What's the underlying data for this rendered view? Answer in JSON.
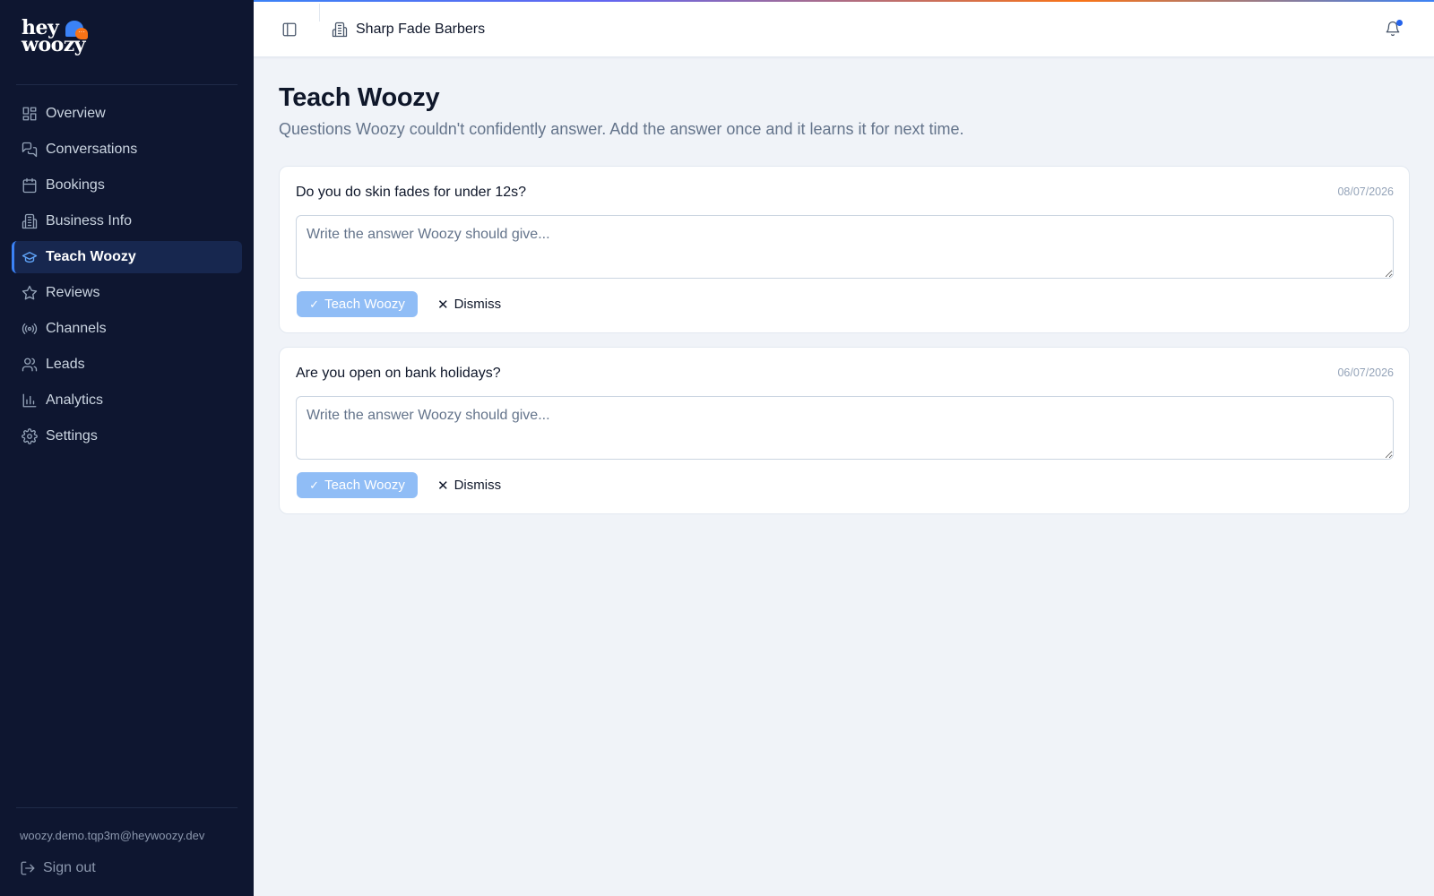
{
  "brand": {
    "line1": "hey",
    "line2": "woozy",
    "bubble_glyph": "···",
    "colors": {
      "blue": "#3b82f6",
      "orange": "#f97316"
    }
  },
  "sidebar": {
    "items": [
      {
        "label": "Overview",
        "icon": "dashboard-icon"
      },
      {
        "label": "Conversations",
        "icon": "chat-icon"
      },
      {
        "label": "Bookings",
        "icon": "calendar-icon"
      },
      {
        "label": "Business Info",
        "icon": "building-icon"
      },
      {
        "label": "Teach Woozy",
        "icon": "graduation-cap-icon",
        "active": true
      },
      {
        "label": "Reviews",
        "icon": "star-icon"
      },
      {
        "label": "Channels",
        "icon": "broadcast-icon"
      },
      {
        "label": "Leads",
        "icon": "users-icon"
      },
      {
        "label": "Analytics",
        "icon": "bar-chart-icon"
      },
      {
        "label": "Settings",
        "icon": "gear-icon"
      }
    ],
    "email": "woozy.demo.tqp3m@heywoozy.dev",
    "sign_out": "Sign out"
  },
  "topbar": {
    "business_name": "Sharp Fade Barbers",
    "has_notification": true
  },
  "main": {
    "title": "Teach Woozy",
    "subtitle": "Questions Woozy couldn't confidently answer. Add the answer once and it learns it for next time.",
    "questions": [
      {
        "question": "Do you do skin fades for under 12s?",
        "date": "08/07/2026",
        "answer": "",
        "placeholder": "Write the answer Woozy should give...",
        "teach_label": "Teach Woozy",
        "dismiss_label": "Dismiss"
      },
      {
        "question": "Are you open on bank holidays?",
        "date": "06/07/2026",
        "answer": "",
        "placeholder": "Write the answer Woozy should give...",
        "teach_label": "Teach Woozy",
        "dismiss_label": "Dismiss"
      }
    ]
  }
}
